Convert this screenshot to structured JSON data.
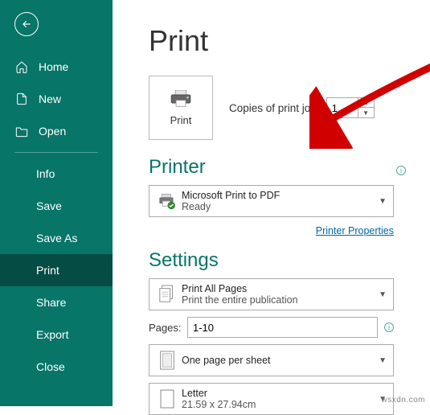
{
  "sidebar": {
    "home": "Home",
    "new": "New",
    "open": "Open",
    "info": "Info",
    "save": "Save",
    "saveAs": "Save As",
    "print": "Print",
    "share": "Share",
    "export": "Export",
    "close": "Close"
  },
  "main": {
    "title": "Print",
    "copiesLabel": "Copies of print job:",
    "copiesValue": "1",
    "printButtonLabel": "Print",
    "printerSection": "Printer",
    "printer": {
      "name": "Microsoft Print to PDF",
      "status": "Ready"
    },
    "printerPropertiesLink": "Printer Properties",
    "settingsSection": "Settings",
    "pagesSetting": {
      "title": "Print All Pages",
      "sub": "Print the entire publication"
    },
    "pagesLabel": "Pages:",
    "pagesValue": "1-10",
    "sheetSetting": "One page per sheet",
    "paperSetting": {
      "title": "Letter",
      "size": "21.59 x 27.94cm"
    }
  },
  "watermark": "wsxdn.com"
}
